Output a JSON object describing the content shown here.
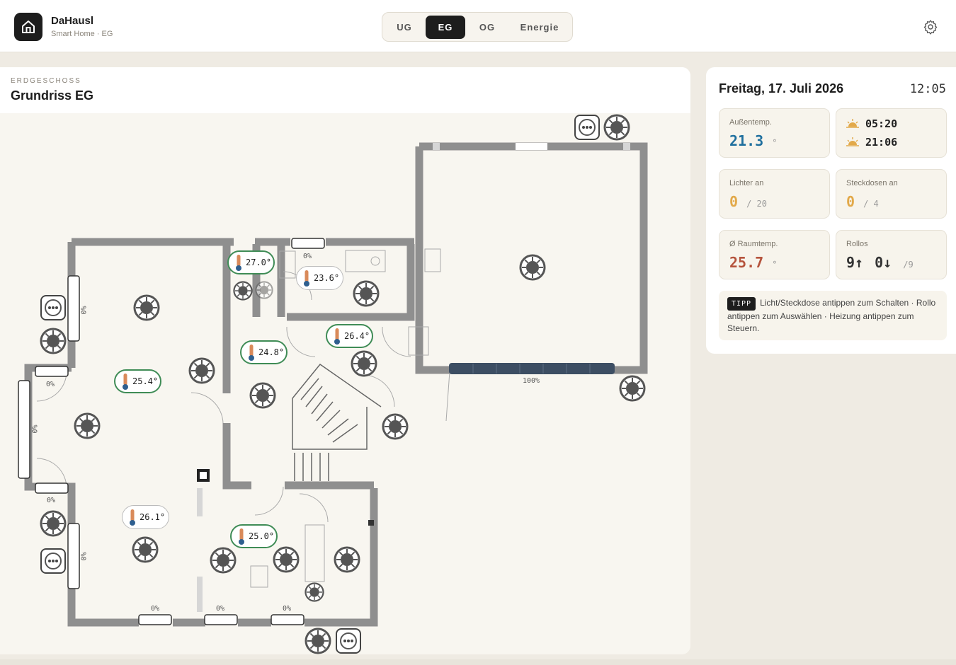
{
  "header": {
    "app_title": "DaHausl",
    "app_subtitle": "Smart Home · EG",
    "tabs": [
      "UG",
      "EG",
      "OG",
      "Energie"
    ],
    "active_tab": "EG"
  },
  "plan": {
    "kicker": "ERDGESCHOSS",
    "title": "Grundriss EG",
    "thermostats": [
      "27.0°",
      "23.6°",
      "26.4°",
      "24.8°",
      "25.4°",
      "26.1°",
      "25.0°"
    ],
    "shutter_labels": [
      "0%",
      "0%",
      "0%",
      "0%",
      "0%",
      "0%",
      "0%",
      "0%",
      "0%",
      "0%",
      "100%"
    ],
    "shutter_levels": [
      0,
      0,
      0,
      0,
      0,
      0,
      0,
      0,
      0,
      0,
      1.0
    ]
  },
  "side": {
    "date": "Freitag, 17. Juli 2026",
    "time": "12:05",
    "outdoor_label": "Außentemp.",
    "outdoor_value": "21.3",
    "outdoor_unit": "°",
    "sunrise": "05:20",
    "sunset": "21:06",
    "lights_label": "Lichter an",
    "lights_on": "0",
    "lights_total": "/ 20",
    "sockets_label": "Steckdosen an",
    "sockets_on": "0",
    "sockets_total": "/ 4",
    "room_temp_label": "Ø Raumtemp.",
    "room_temp_value": "25.7",
    "room_temp_unit": "°",
    "shutters_label": "Rollos",
    "shutters_up": "9↑",
    "shutters_down": "0↓",
    "shutters_total": "/9",
    "tip_badge": "TIPP",
    "tip_text": "Licht/Steckdose antippen zum Schalten · Rollo antippen zum Auswählen · Heizung antippen zum Steuern."
  },
  "colors": {
    "accent_dark": "#1d1d1d",
    "outdoor_temp": "#1f6f9e",
    "count_zero": "#e2a94a",
    "room_temp": "#b5533c",
    "thermo_border": "#3f8c56",
    "shutter_bar": "#3d4e63"
  }
}
